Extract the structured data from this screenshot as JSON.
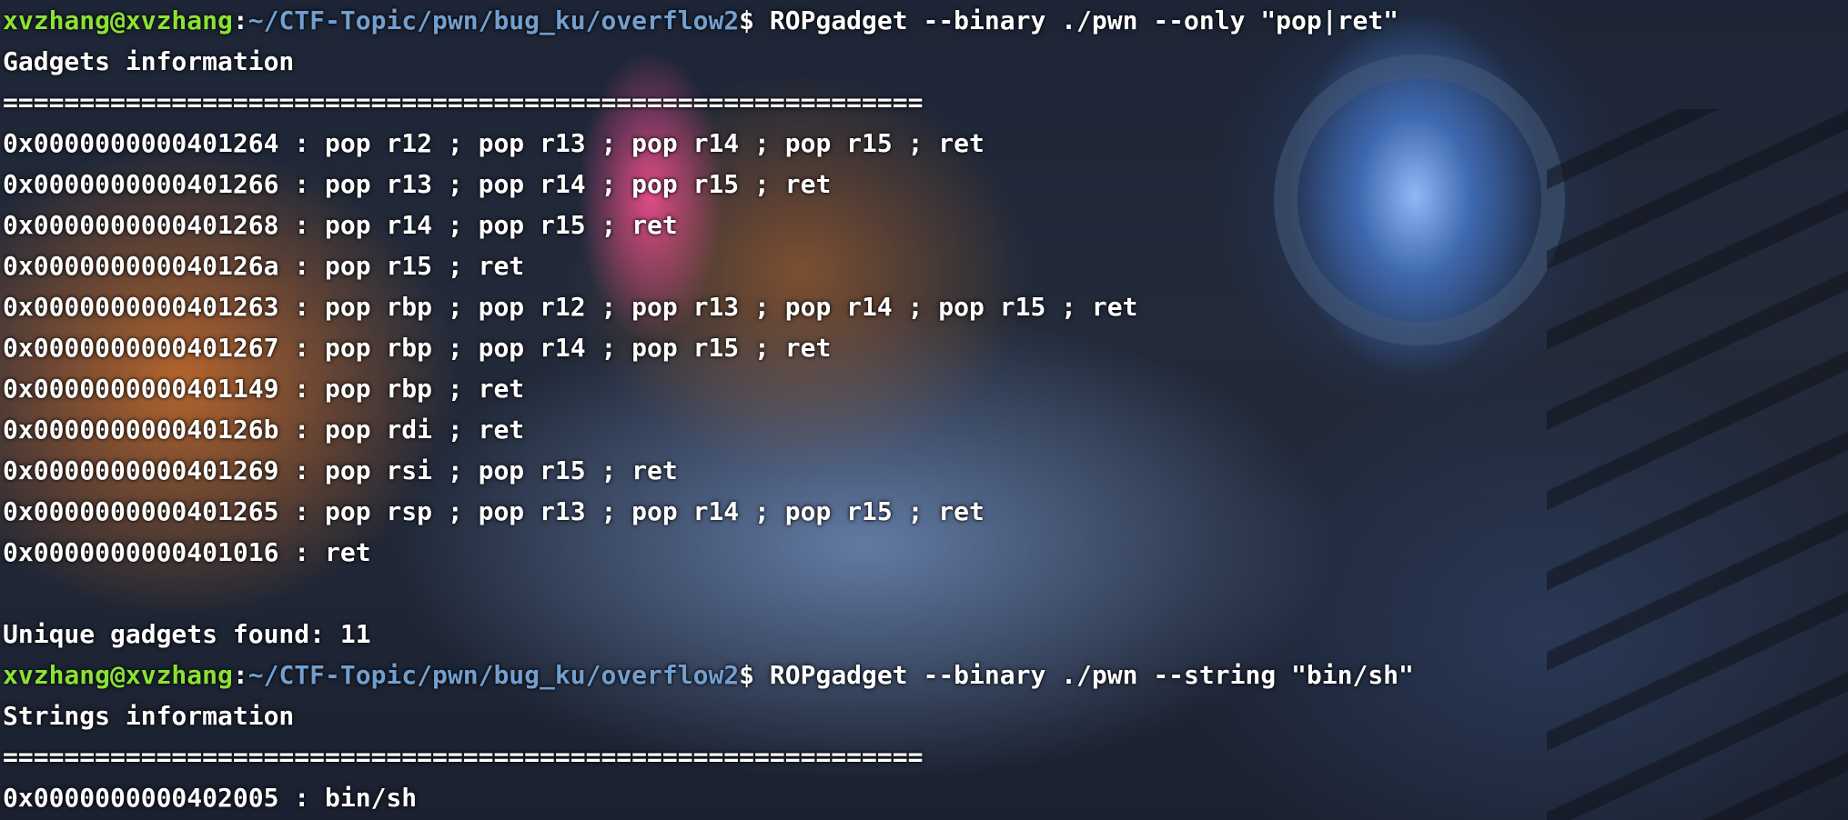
{
  "terminal": {
    "colors": {
      "prompt_user": "#8ae234",
      "prompt_path": "#729fcf",
      "text": "#ffffff"
    },
    "blocks": [
      {
        "prompt": {
          "user_host": "xvzhang@xvzhang",
          "separator": ":",
          "path": "~/CTF-Topic/pwn/bug_ku/overflow2",
          "dollar": "$",
          "command": " ROPgadget --binary ./pwn --only \"pop|ret\""
        },
        "header": "Gadgets information",
        "divider": "============================================================",
        "lines": [
          "0x0000000000401264 : pop r12 ; pop r13 ; pop r14 ; pop r15 ; ret",
          "0x0000000000401266 : pop r13 ; pop r14 ; pop r15 ; ret",
          "0x0000000000401268 : pop r14 ; pop r15 ; ret",
          "0x000000000040126a : pop r15 ; ret",
          "0x0000000000401263 : pop rbp ; pop r12 ; pop r13 ; pop r14 ; pop r15 ; ret",
          "0x0000000000401267 : pop rbp ; pop r14 ; pop r15 ; ret",
          "0x0000000000401149 : pop rbp ; ret",
          "0x000000000040126b : pop rdi ; ret",
          "0x0000000000401269 : pop rsi ; pop r15 ; ret",
          "0x0000000000401265 : pop rsp ; pop r13 ; pop r14 ; pop r15 ; ret",
          "0x0000000000401016 : ret"
        ],
        "footer": "Unique gadgets found: 11"
      },
      {
        "prompt": {
          "user_host": "xvzhang@xvzhang",
          "separator": ":",
          "path": "~/CTF-Topic/pwn/bug_ku/overflow2",
          "dollar": "$",
          "command": " ROPgadget --binary ./pwn --string \"bin/sh\""
        },
        "header": "Strings information",
        "divider": "============================================================",
        "lines": [
          "0x0000000000402005 : bin/sh"
        ]
      }
    ]
  }
}
